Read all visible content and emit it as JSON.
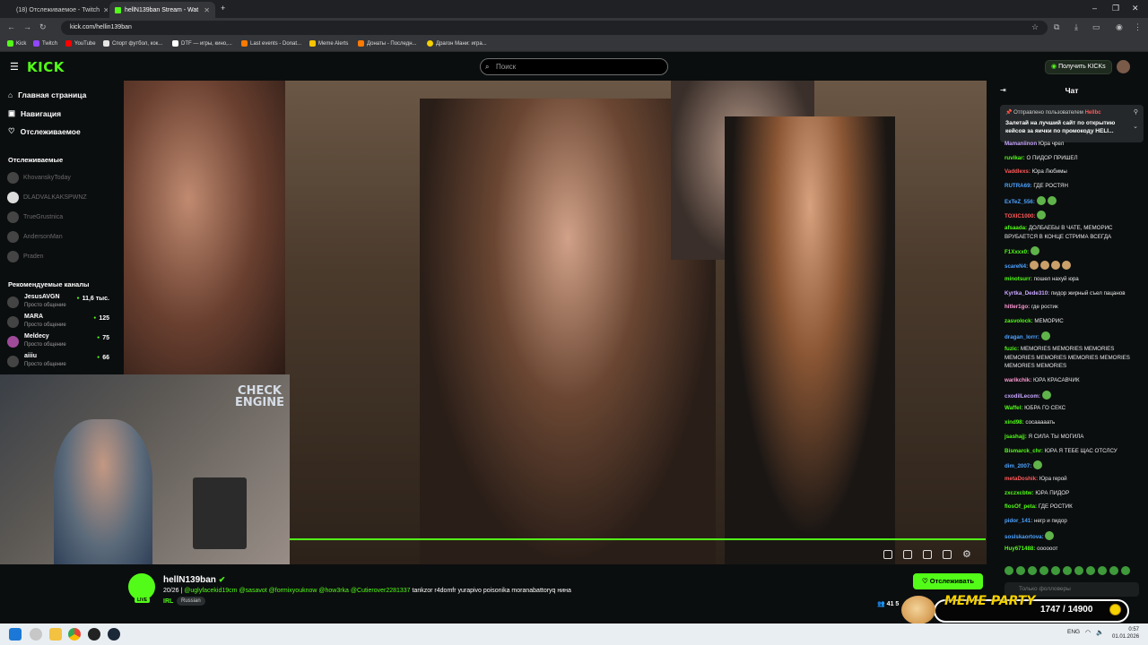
{
  "browser": {
    "tabs": [
      {
        "label": "(18) Отслеживаемое - Twitch"
      },
      {
        "label": "hellN139ban Stream - Wat"
      }
    ],
    "url": "kick.com/hellin139ban",
    "bookmarks": [
      {
        "label": "Kick"
      },
      {
        "label": "Twitch"
      },
      {
        "label": "YouTube"
      },
      {
        "label": "Спорт футбол, кок..."
      },
      {
        "label": "DTF — игры, кино,..."
      },
      {
        "label": "Last events - Donat..."
      },
      {
        "label": "Meme Alerts"
      },
      {
        "label": "Донаты - Последн..."
      },
      {
        "label": "Драгон Мани: игра..."
      }
    ]
  },
  "header": {
    "logo": "KICK",
    "search_placeholder": "Поиск",
    "get_kicks_label": "Получить KICKs"
  },
  "sidebar": {
    "nav": [
      {
        "label": "Главная страница",
        "icon": "home-icon"
      },
      {
        "label": "Навигация",
        "icon": "compass-icon"
      },
      {
        "label": "Отслеживаемое",
        "icon": "heart-icon"
      }
    ],
    "following_title": "Отслеживаемые",
    "following": [
      {
        "name": "KhovanskyToday"
      },
      {
        "name": "DLADVALKAKSPWNZ"
      },
      {
        "name": "TrueGrustnica"
      },
      {
        "name": "AndersonMan"
      },
      {
        "name": "Praden"
      }
    ],
    "recommended_title": "Рекомендуемые каналы",
    "recommended": [
      {
        "name": "JesusAVGN",
        "sub": "Просто общение",
        "viewers": "11,6 тыс."
      },
      {
        "name": "MARA",
        "sub": "Просто общение",
        "viewers": "125"
      },
      {
        "name": "Meldecy",
        "sub": "Просто общение",
        "viewers": "75"
      },
      {
        "name": "aiiiu",
        "sub": "Просто общение",
        "viewers": "66"
      }
    ]
  },
  "webcam": {
    "sign_line1": "CHECK",
    "sign_line2": "ENGINE"
  },
  "stream": {
    "channel": "hellN139ban",
    "title_counter": "20/26",
    "mentions": [
      "@uglyfacekid19cm",
      "@sasavot",
      "@formixyouknow",
      "@how3rka",
      "@Cutierover2281337"
    ],
    "title_rest": "tankzor r4domfr yurapivo poisonika moranabattoryq нина",
    "category": "IRL",
    "language": "Russian",
    "follow_label": "Отслеживать",
    "viewers": "41 5"
  },
  "chat": {
    "title": "Чат",
    "pinned_by": "Отправлено пользователем",
    "pinned_user": "Hellbc",
    "pinned_message": "Залетай на лучший сайт по открытию кейсов за яички по промокоду HELI...",
    "messages": [
      {
        "user": "Mamaniinon",
        "text": "Юра чрел",
        "color": "#c8a6ff"
      },
      {
        "user": "ruvikar:",
        "text": "О ПИДОР ПРИШЕЛ",
        "color": "#53fc18"
      },
      {
        "user": "Vaddlexs:",
        "text": "Юра Любимы",
        "color": "#ff5a5a"
      },
      {
        "user": "RUTRA69:",
        "text": "ГДЕ РОСТЯН",
        "color": "#4da3ff"
      },
      {
        "user": "ExTeZ_556:",
        "text": "",
        "color": "#4da3ff",
        "emotes": 2
      },
      {
        "user": "TOXIC1000:",
        "text": "",
        "color": "#ff5a5a",
        "emotes": 1
      },
      {
        "user": "afsaada:",
        "text": "ДОЛБАЕБЫ В ЧАТЕ, МЕМОРИС ВРУБАЕТСЯ В КОНЦЕ СТРИМА ВСЕГДА",
        "color": "#53fc18"
      },
      {
        "user": "F1Xxxx0:",
        "text": "",
        "color": "#53fc18",
        "emotes": 1
      },
      {
        "user": "scareN4:",
        "text": "",
        "color": "#4da3ff",
        "emotes": 4
      },
      {
        "user": "minotsurr:",
        "text": "пошел нахуй юра",
        "color": "#53fc18"
      },
      {
        "user": "Kyrtka_Dede310:",
        "text": "пидор жирный съел пацанов",
        "color": "#c8a6ff"
      },
      {
        "user": "hitler1go:",
        "text": "где ростик",
        "color": "#ff9ad5"
      },
      {
        "user": "zasvolock:",
        "text": "МЕМОРИС",
        "color": "#53fc18"
      },
      {
        "user": "dragan_lorrr:",
        "text": "",
        "color": "#4da3ff",
        "emotes": 1
      },
      {
        "user": "fuzic:",
        "text": "MEMORIES MEMORIES MEMORIES MEMORIES MEMORIES MEMORIES MEMORIES MEMORIES MEMORIES",
        "color": "#53fc18"
      },
      {
        "user": "warikchik:",
        "text": "ЮРА КРАСАВЧИК",
        "color": "#ff9ad5"
      },
      {
        "user": "cxodilLecom:",
        "text": "",
        "color": "#c8a6ff",
        "emotes": 1
      },
      {
        "user": "Waffel:",
        "text": "ЮБРА ГО СЕКС",
        "color": "#53fc18"
      },
      {
        "user": "xind98:",
        "text": "сосааааать",
        "color": "#53fc18"
      },
      {
        "user": "jsashajj:",
        "text": "Я СИЛА ТЫ МОГИЛА",
        "color": "#53fc18"
      },
      {
        "user": "Bismarck_chr:",
        "text": "ЮРА Я ТЕБЕ ЩАС ОТСЛСУ",
        "color": "#53fc18"
      },
      {
        "user": "dim_2007:",
        "text": "",
        "color": "#4da3ff",
        "emotes": 1
      },
      {
        "user": "metaDoshik:",
        "text": "Юра герой",
        "color": "#ff5a5a"
      },
      {
        "user": "zxczxcbtw:",
        "text": "ЮРА ПИДОР",
        "color": "#53fc18"
      },
      {
        "user": "flosOf_peta:",
        "text": "ГДЕ РОСТИК",
        "color": "#53fc18"
      },
      {
        "user": "pidor_141:",
        "text": "негр и пидор",
        "color": "#4da3ff"
      },
      {
        "user": "soslskaortova:",
        "text": "",
        "color": "#4da3ff",
        "emotes": 1
      },
      {
        "user": "Huy671488:",
        "text": "оооооот",
        "color": "#53fc18"
      }
    ],
    "input_placeholder": "Только фолловеры"
  },
  "overlay": {
    "title": "MEME PARTY",
    "progress": "1747 / 14900"
  },
  "taskbar": {
    "lang": "ENG",
    "time": "0:57",
    "date": "01.01.2026"
  }
}
